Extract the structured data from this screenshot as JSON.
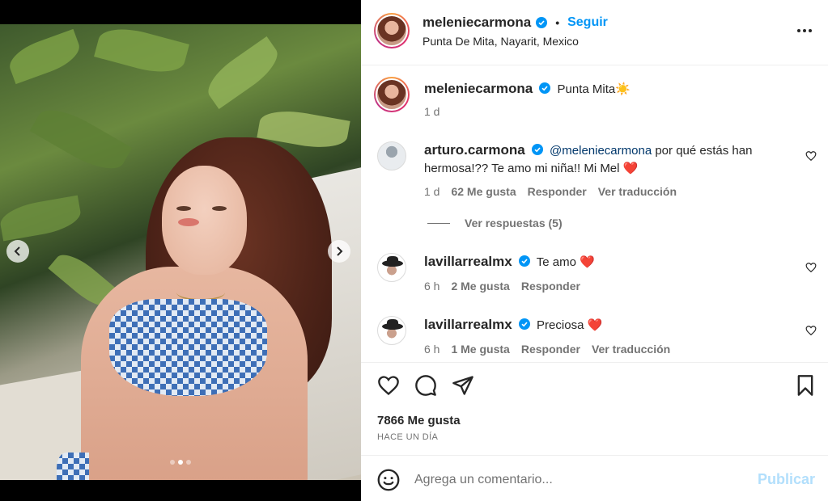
{
  "post": {
    "username": "meleniecarmona",
    "follow_label": "Seguir",
    "separator": "•",
    "location": "Punta De Mita, Nayarit, Mexico",
    "caption": "Punta Mita☀️",
    "caption_time": "1 d"
  },
  "carousel": {
    "total": 3,
    "current": 2
  },
  "comments": [
    {
      "username": "arturo.carmona",
      "mention": "@meleniecarmona",
      "text": "por qué estás han",
      "text_line2": "hermosa!?? Te amo mi niña!! Mi Mel ❤️",
      "time": "1 d",
      "likes": "62 Me gusta",
      "reply": "Responder",
      "translate": "Ver traducción",
      "view_replies": "Ver respuestas (5)"
    },
    {
      "username": "lavillarrealmx",
      "text": "Te amo ❤️",
      "time": "6 h",
      "likes": "2 Me gusta",
      "reply": "Responder"
    },
    {
      "username": "lavillarrealmx",
      "text": "Preciosa ❤️",
      "time": "6 h",
      "likes": "1 Me gusta",
      "reply": "Responder",
      "translate": "Ver traducción"
    }
  ],
  "footer": {
    "likes_count": "7866 Me gusta",
    "time": "HACE UN DÍA",
    "comment_placeholder": "Agrega un comentario...",
    "publish_label": "Publicar"
  },
  "icons": {
    "heart": "heart-icon",
    "comment": "comment-icon",
    "share": "share-icon",
    "save": "bookmark-icon",
    "emoji": "emoji-icon",
    "more": "more-options-icon",
    "verified": "verified-badge-icon",
    "prev": "chevron-left-icon",
    "next": "chevron-right-icon"
  },
  "colors": {
    "accent": "#0095f6",
    "verified": "#0095f6",
    "muted": "#737373",
    "publish_disabled": "#b2dffc"
  }
}
